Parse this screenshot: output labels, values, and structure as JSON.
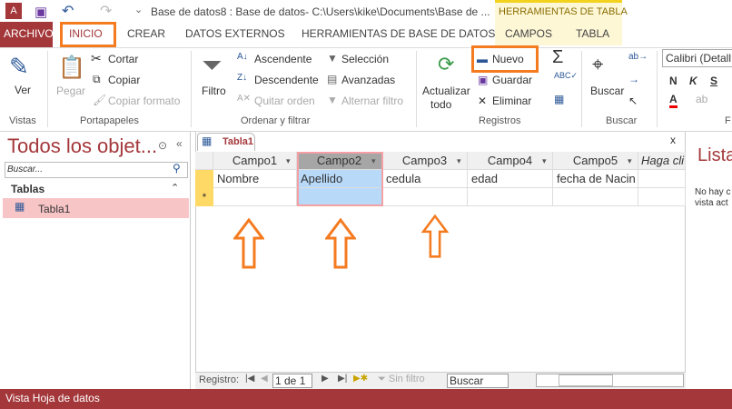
{
  "title_bar": {
    "title": "Base de datos8 : Base de datos- C:\\Users\\kike\\Documents\\Base de ...",
    "context_group": "HERRAMIENTAS DE TABLA"
  },
  "tabs": [
    "ARCHIVO",
    "INICIO",
    "CREAR",
    "DATOS EXTERNOS",
    "HERRAMIENTAS DE BASE DE DATOS",
    "CAMPOS",
    "TABLA"
  ],
  "ribbon": {
    "vistas": {
      "label": "Vistas",
      "ver": "Ver"
    },
    "portapapeles": {
      "label": "Portapapeles",
      "pegar": "Pegar",
      "cortar": "Cortar",
      "copiar": "Copiar",
      "copiar_formato": "Copiar formato"
    },
    "ordenar": {
      "label": "Ordenar y filtrar",
      "filtro": "Filtro",
      "ascendente": "Ascendente",
      "descendente": "Descendente",
      "quitar_orden": "Quitar orden",
      "seleccion": "Selección",
      "avanzadas": "Avanzadas",
      "alternar": "Alternar filtro"
    },
    "registros": {
      "label": "Registros",
      "actualizar": "Actualizar",
      "todo": "todo",
      "nuevo": "Nuevo",
      "guardar": "Guardar",
      "eliminar": "Eliminar"
    },
    "buscar": {
      "label": "Buscar",
      "buscar": "Buscar"
    },
    "fuente": {
      "label": "F",
      "font": "Calibri (Detall",
      "bold": "N",
      "italic": "K",
      "underline": "S"
    }
  },
  "nav": {
    "title": "Todos los objet...",
    "search_placeholder": "Buscar...",
    "section": "Tablas",
    "items": [
      "Tabla1"
    ]
  },
  "document": {
    "tab": "Tabla1",
    "close": "x",
    "columns": [
      "Campo1",
      "Campo2",
      "Campo3",
      "Campo4",
      "Campo5",
      "Haga cli"
    ],
    "rows": [
      [
        "Nombre",
        "Apellido",
        "cedula",
        "edad",
        "fecha de Nacin"
      ]
    ],
    "new_row_marker": "*"
  },
  "record_nav": {
    "label": "Registro:",
    "position": "1 de 1",
    "filter": "Sin filtro",
    "search": "Buscar"
  },
  "right_pane": {
    "title": "Lista",
    "line1": "No hay c",
    "line2": "vista act"
  },
  "status": "Vista Hoja de datos",
  "colors": {
    "accent": "#a4373a",
    "highlight": "#f47b20"
  }
}
